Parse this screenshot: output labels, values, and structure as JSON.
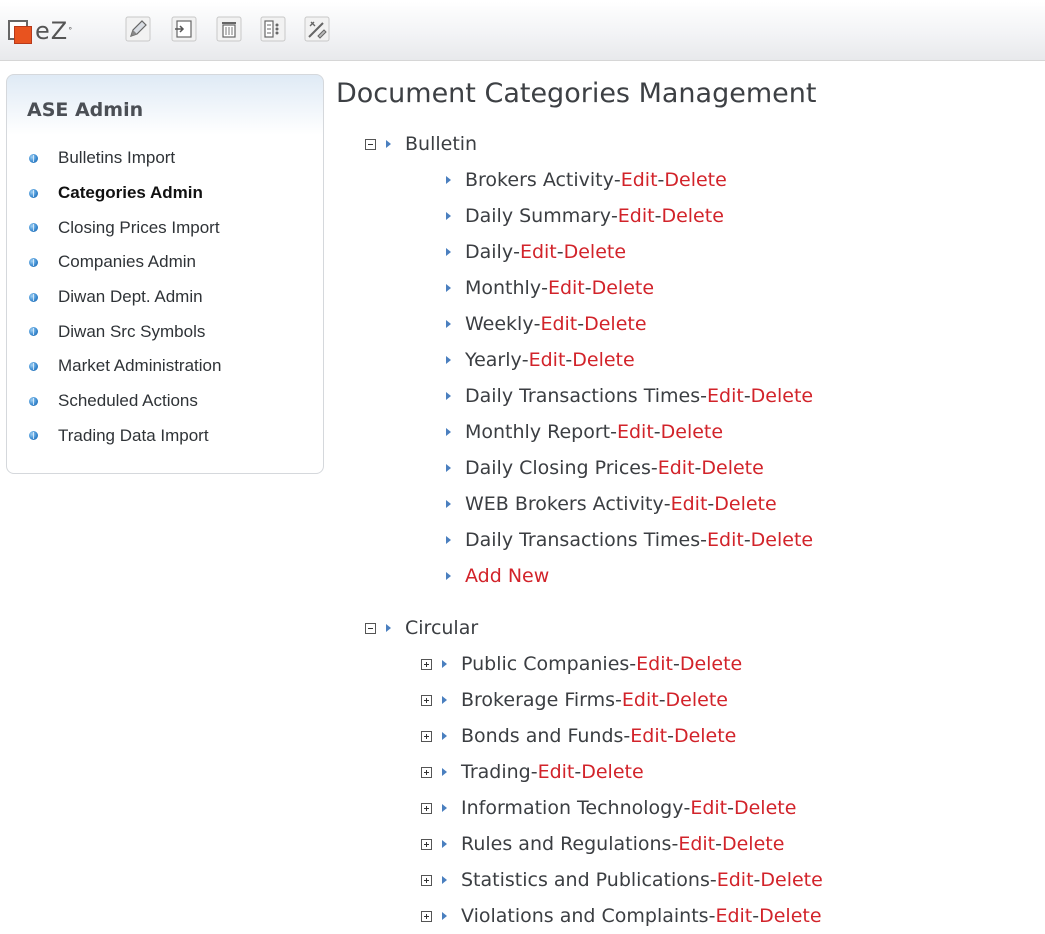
{
  "logo": {
    "text": "eZ",
    "mark": "°"
  },
  "toolbar_buttons": [
    "edit-pencil-icon",
    "import-icon",
    "trash-icon",
    "list-icon",
    "tools-icon"
  ],
  "sidebar": {
    "title": "ASE Admin",
    "items": [
      {
        "label": "Bulletins Import",
        "active": false
      },
      {
        "label": "Categories Admin",
        "active": true
      },
      {
        "label": "Closing Prices Import",
        "active": false
      },
      {
        "label": "Companies Admin",
        "active": false
      },
      {
        "label": "Diwan Dept. Admin",
        "active": false
      },
      {
        "label": "Diwan Src Symbols",
        "active": false
      },
      {
        "label": "Market Administration",
        "active": false
      },
      {
        "label": "Scheduled Actions",
        "active": false
      },
      {
        "label": "Trading Data Import",
        "active": false
      }
    ]
  },
  "main": {
    "title": "Document Categories Management",
    "edit_label": "Edit",
    "delete_label": "Delete",
    "separator": " - ",
    "add_new_label": "Add New",
    "categories": [
      {
        "name": "Bulletin",
        "children": [
          {
            "name": "Brokers Activity"
          },
          {
            "name": "Daily Summary"
          },
          {
            "name": "Daily"
          },
          {
            "name": "Monthly"
          },
          {
            "name": "Weekly"
          },
          {
            "name": "Yearly"
          },
          {
            "name": "Daily Transactions Times"
          },
          {
            "name": "Monthly Report"
          },
          {
            "name": "Daily Closing Prices"
          },
          {
            "name": "WEB Brokers Activity"
          },
          {
            "name": "Daily Transactions Times"
          }
        ]
      },
      {
        "name": "Circular",
        "children": [
          {
            "name": "Public Companies"
          },
          {
            "name": "Brokerage Firms"
          },
          {
            "name": "Bonds and Funds"
          },
          {
            "name": "Trading"
          },
          {
            "name": "Information Technology"
          },
          {
            "name": "Rules and Regulations"
          },
          {
            "name": "Statistics and Publications"
          },
          {
            "name": "Violations and Complaints"
          }
        ]
      }
    ]
  },
  "colors": {
    "link_red": "#d2232a",
    "bullet_blue": "#3a8ad0",
    "accent_orange": "#e8531f"
  }
}
